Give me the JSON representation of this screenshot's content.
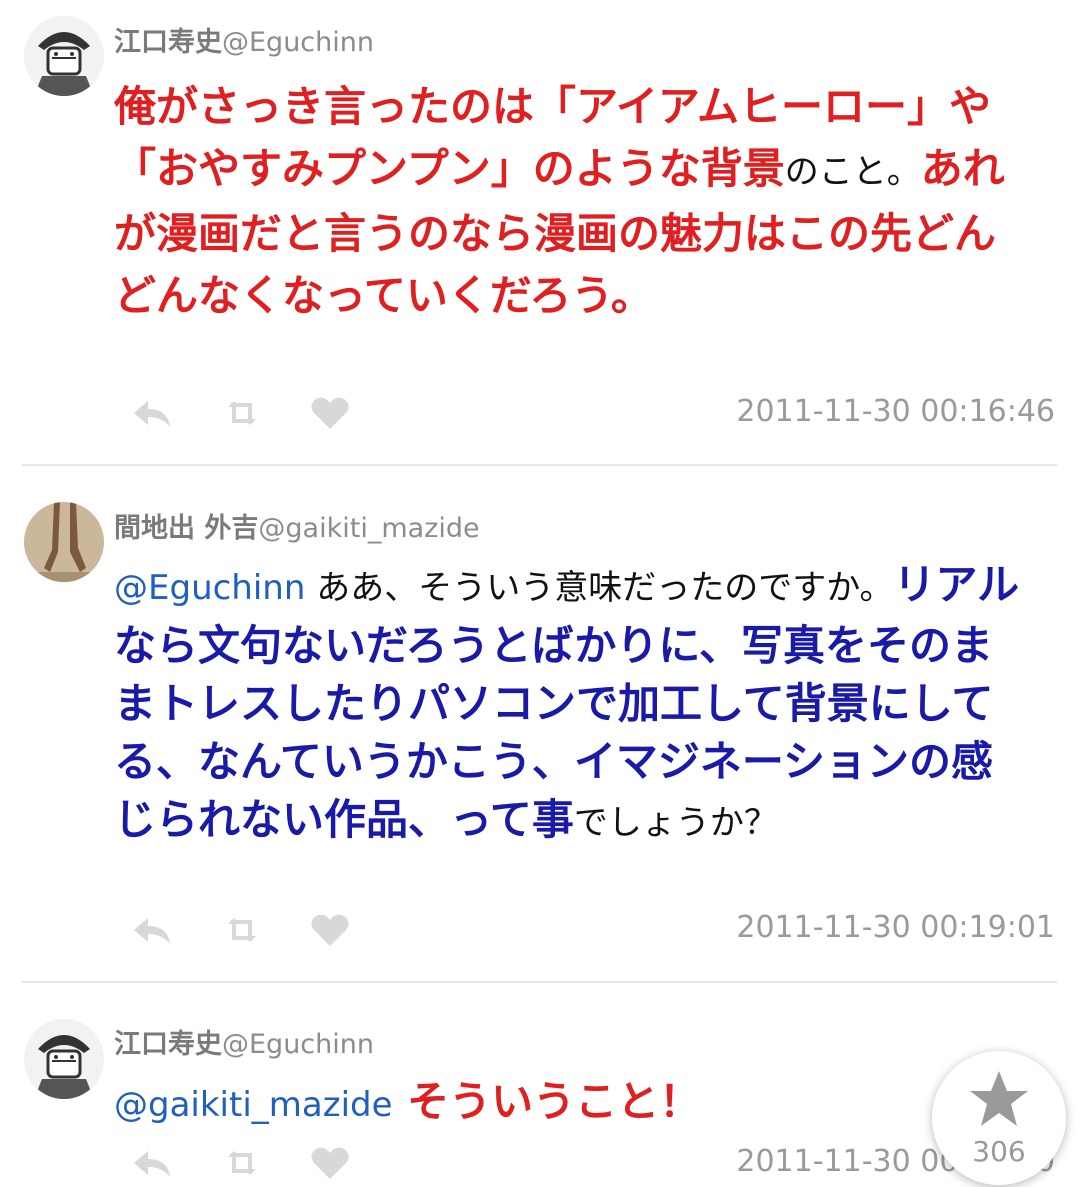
{
  "colors": {
    "red_text": "#e02020",
    "blue_text": "#1a1aa8",
    "mention": "#1f5fbf",
    "meta": "#9a9a9a"
  },
  "icons": {
    "reply": "reply-icon",
    "retweet": "retweet-icon",
    "like": "heart-icon",
    "favorite_fab": "star-icon"
  },
  "tweets": [
    {
      "author_name": "江口寿史",
      "author_handle": "@Eguchinn",
      "body": {
        "red1": "俺がさっき言ったのは「アイアムヒーロー」や「おやすみプンプン」のような背景",
        "plain1": "のこと。",
        "red2": "あれが漫画だと言うのなら漫画の魅力はこの先どんどんなくなっていくだろう。"
      },
      "timestamp": "2011-11-30 00:16:46"
    },
    {
      "author_name": "間地出 外吉",
      "author_handle": "@gaikiti_mazide",
      "body": {
        "mention": "@Eguchinn",
        "plain1": " ああ、そういう意味だったのですか。",
        "blue1": "リアルなら文句ないだろうとばかりに、写真をそのままトレスしたりパソコンで加工して背景にしてる、なんていうかこう、イマジネーションの感じられない作品、って事",
        "plain2": "でしょうか？"
      },
      "timestamp": "2011-11-30 00:19:01"
    },
    {
      "author_name": "江口寿史",
      "author_handle": "@Eguchinn",
      "body": {
        "mention": "@gaikiti_mazide",
        "red1": " そういうこと！"
      },
      "timestamp": "2011-11-30 00:20:00"
    }
  ],
  "favorite_button": {
    "count": "306"
  }
}
